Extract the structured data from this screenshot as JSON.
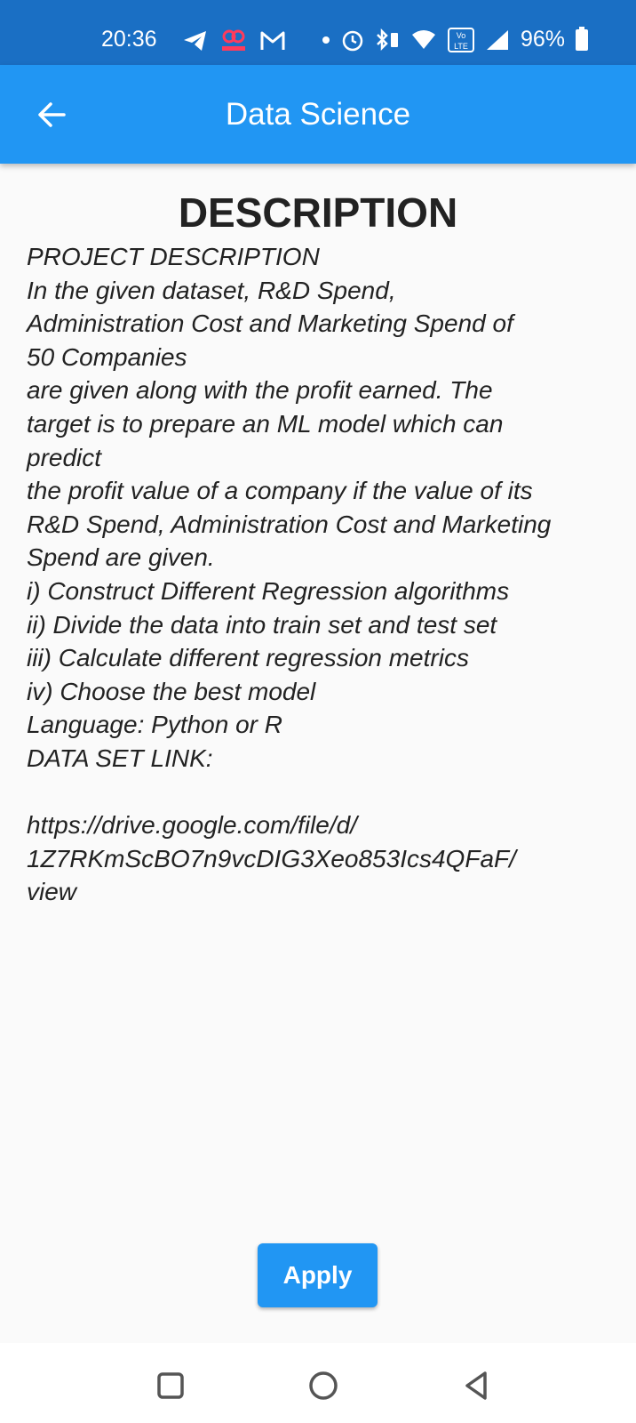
{
  "status_bar": {
    "time": "20:36",
    "battery": "96%",
    "icons": [
      "telegram-icon",
      "moj-icon",
      "gmail-icon",
      "dot-icon",
      "alarm-icon",
      "bluetooth-icon",
      "wifi-icon",
      "volte-icon",
      "signal-icon",
      "battery-icon"
    ]
  },
  "app_bar": {
    "title": "Data Science",
    "back_icon": "arrow-left-icon"
  },
  "content": {
    "heading": "DESCRIPTION",
    "description": "PROJECT DESCRIPTION\nIn the given dataset, R&D Spend,\nAdministration Cost and Marketing Spend of\n50 Companies\nare given along with the profit earned. The\ntarget is to prepare an ML model which can\npredict\nthe profit value of a company if the value of its\nR&D Spend, Administration Cost and Marketing\nSpend are given.\ni) Construct Different Regression algorithms\nii) Divide the data into train set and test set\niii) Calculate different regression metrics\niv) Choose the best model\nLanguage: Python or R\nDATA SET LINK:\n\nhttps://drive.google.com/file/d/\n1Z7RKmScBO7n9vcDIG3Xeo853Ics4QFaF/\nview"
  },
  "actions": {
    "apply_label": "Apply"
  },
  "colors": {
    "status_bar": "#1a6fc4",
    "app_bar": "#2196f3",
    "background": "#fafafa",
    "button": "#2196f3"
  },
  "nav_bar": {
    "items": [
      "recents-icon",
      "home-icon",
      "back-icon"
    ]
  }
}
